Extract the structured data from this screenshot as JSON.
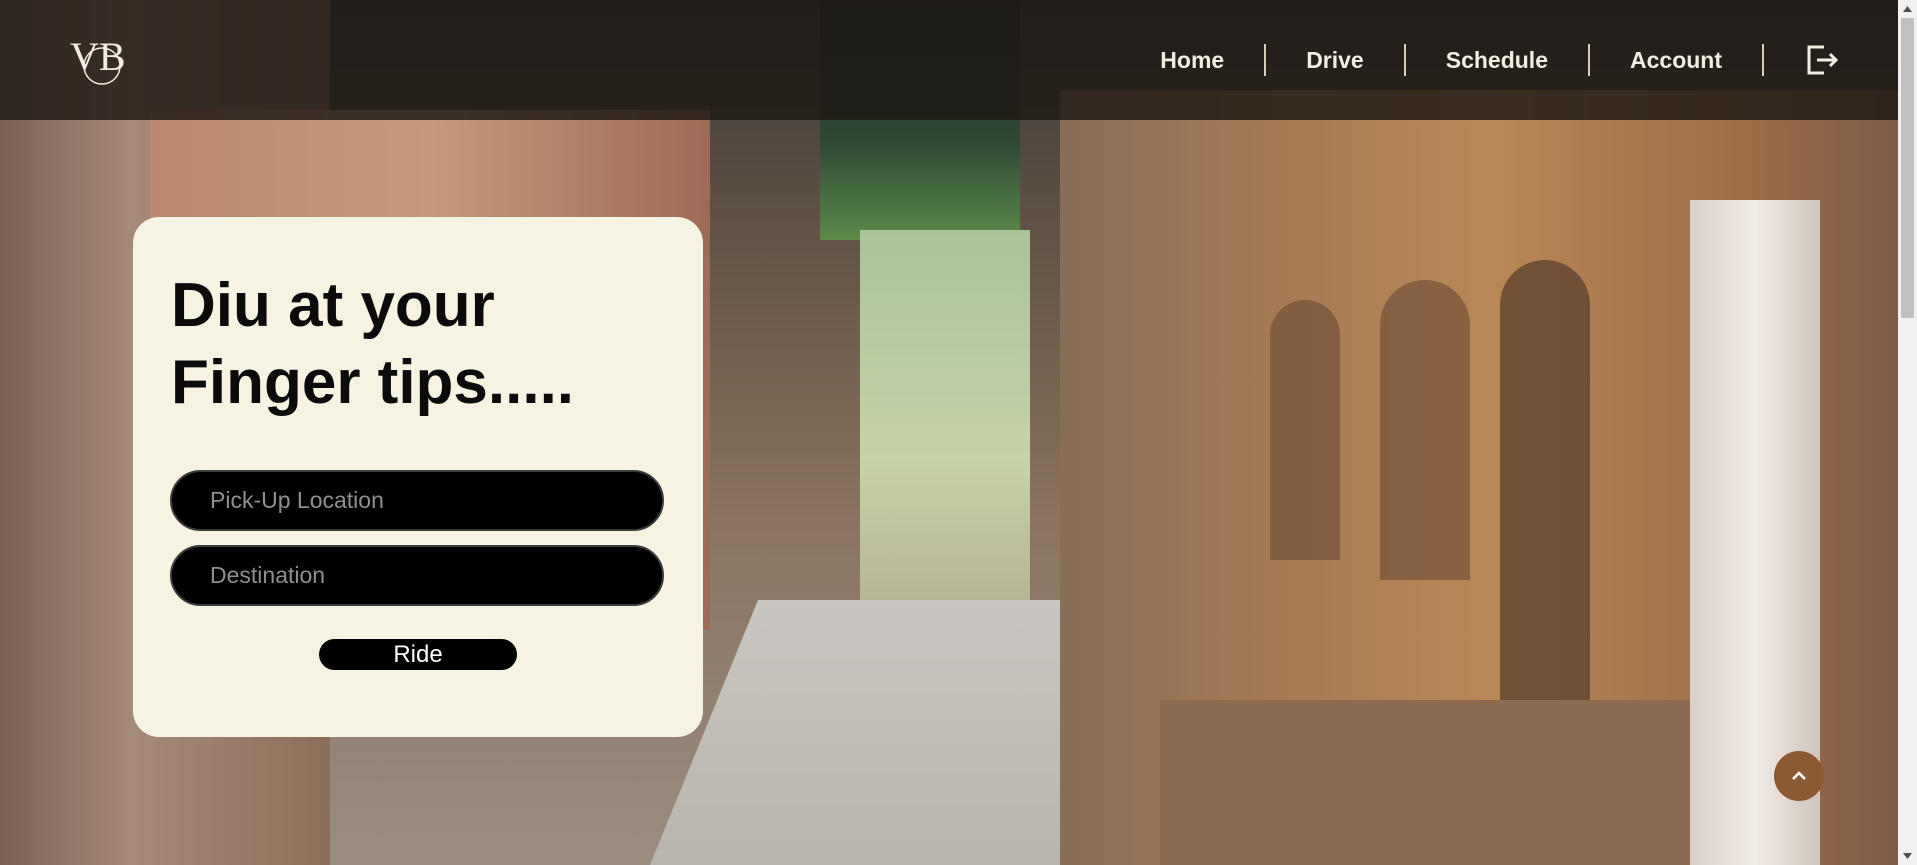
{
  "header": {
    "logo_text": "VB",
    "nav": [
      {
        "label": "Home"
      },
      {
        "label": "Drive"
      },
      {
        "label": "Schedule"
      },
      {
        "label": "Account"
      }
    ],
    "logout_icon": "logout-icon"
  },
  "hero": {
    "title": "Diu at your Finger tips.....",
    "pickup_placeholder": "Pick-Up Location",
    "destination_placeholder": "Destination",
    "ride_label": "Ride"
  },
  "scroll_top_icon": "chevron-up-icon",
  "colors": {
    "header_bg": "#1e1814",
    "card_bg": "#f7f3e3",
    "input_bg": "#000000",
    "accent": "#8a5a34"
  }
}
